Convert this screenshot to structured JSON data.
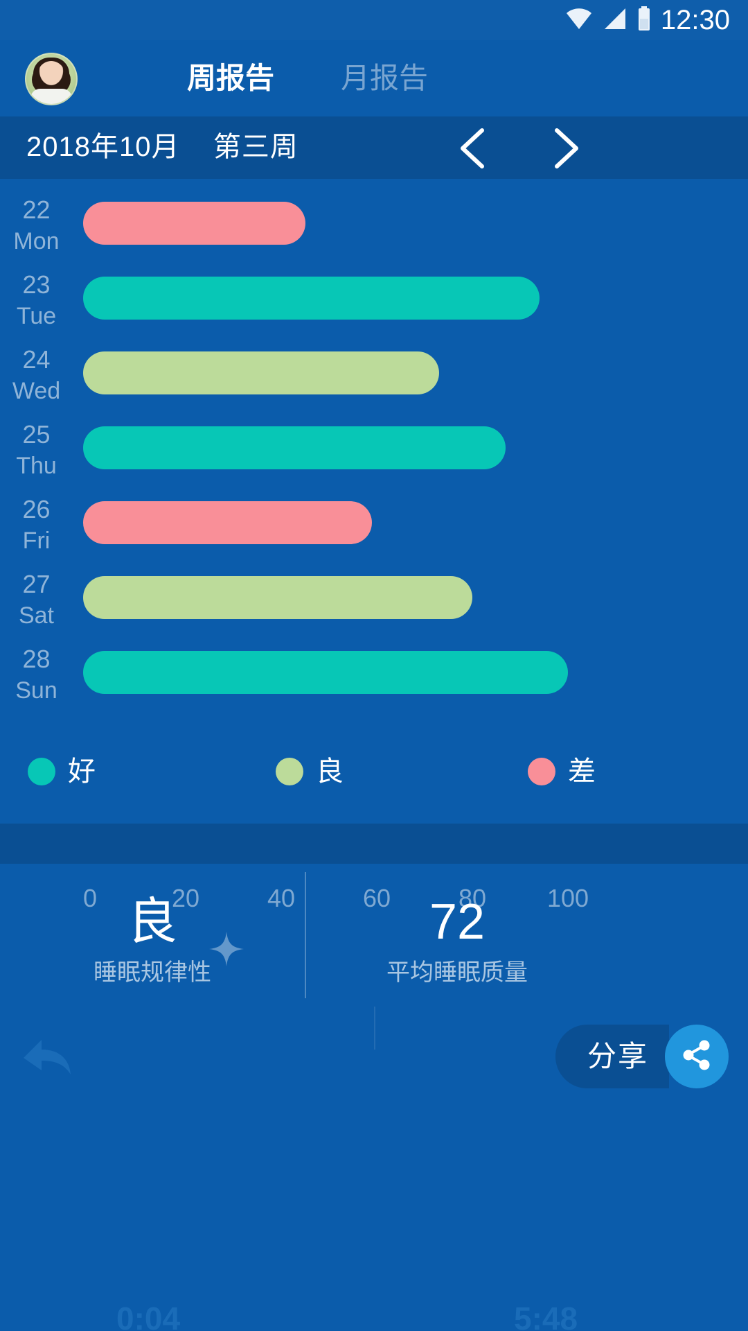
{
  "status_bar": {
    "time": "12:30",
    "icons": [
      "wifi-icon",
      "cellular-signal-icon",
      "battery-icon"
    ]
  },
  "header": {
    "avatar_name": "user-avatar",
    "tabs": [
      {
        "label": "周报告",
        "active": true
      },
      {
        "label": "月报告",
        "active": false
      }
    ]
  },
  "date_bar": {
    "date_text": "2018年10月    第三周",
    "prev_icon": "chevron-left-icon",
    "next_icon": "chevron-right-icon"
  },
  "chart_data": {
    "type": "bar",
    "orientation": "horizontal",
    "title": "",
    "xlabel": "",
    "ylabel": "",
    "xlim": [
      0,
      100
    ],
    "xticks": [
      "0",
      "20",
      "40",
      "60",
      "80",
      "100"
    ],
    "grid": false,
    "categories": [
      "22 Mon",
      "23 Tue",
      "24 Wed",
      "25 Thu",
      "26 Fri",
      "27 Sat",
      "28 Sun"
    ],
    "rows": [
      {
        "day_number": "22",
        "day_name": "Mon",
        "value": 45,
        "quality": "差",
        "color": "#f98f98"
      },
      {
        "day_number": "23",
        "day_name": "Tue",
        "value": 94,
        "quality": "好",
        "color": "#07c7b6"
      },
      {
        "day_number": "24",
        "day_name": "Wed",
        "value": 73,
        "quality": "良",
        "color": "#bcdb9a"
      },
      {
        "day_number": "25",
        "day_name": "Thu",
        "value": 87,
        "quality": "好",
        "color": "#07c7b6"
      },
      {
        "day_number": "26",
        "day_name": "Fri",
        "value": 59,
        "quality": "差",
        "color": "#f98f98"
      },
      {
        "day_number": "27",
        "day_name": "Sat",
        "value": 80,
        "quality": "良",
        "color": "#bcdb9a"
      },
      {
        "day_number": "28",
        "day_name": "Sun",
        "value": 100,
        "quality": "好",
        "color": "#07c7b6"
      }
    ],
    "legend": {
      "position": "bottom",
      "entries": [
        {
          "label": "好",
          "color": "#07c7b6"
        },
        {
          "label": "良",
          "color": "#bcdb9a"
        },
        {
          "label": "差",
          "color": "#f98f98"
        }
      ]
    }
  },
  "stats": [
    {
      "value": "良",
      "label": "睡眠规律性"
    },
    {
      "value": "72",
      "label": "平均睡眠质量"
    }
  ],
  "bottom_bar": {
    "back_icon": "back-arrow-icon",
    "share_label": "分享",
    "share_icon": "share-nodes-icon",
    "ghost_left": "0:04",
    "ghost_right": "5:48"
  },
  "colors": {
    "background": "#0b5cab",
    "header_dark": "#0a4f93",
    "accent": "#2196dd",
    "good": "#07c7b6",
    "fair": "#bcdb9a",
    "poor": "#f98f98",
    "muted_text": "#8fb4d8"
  }
}
